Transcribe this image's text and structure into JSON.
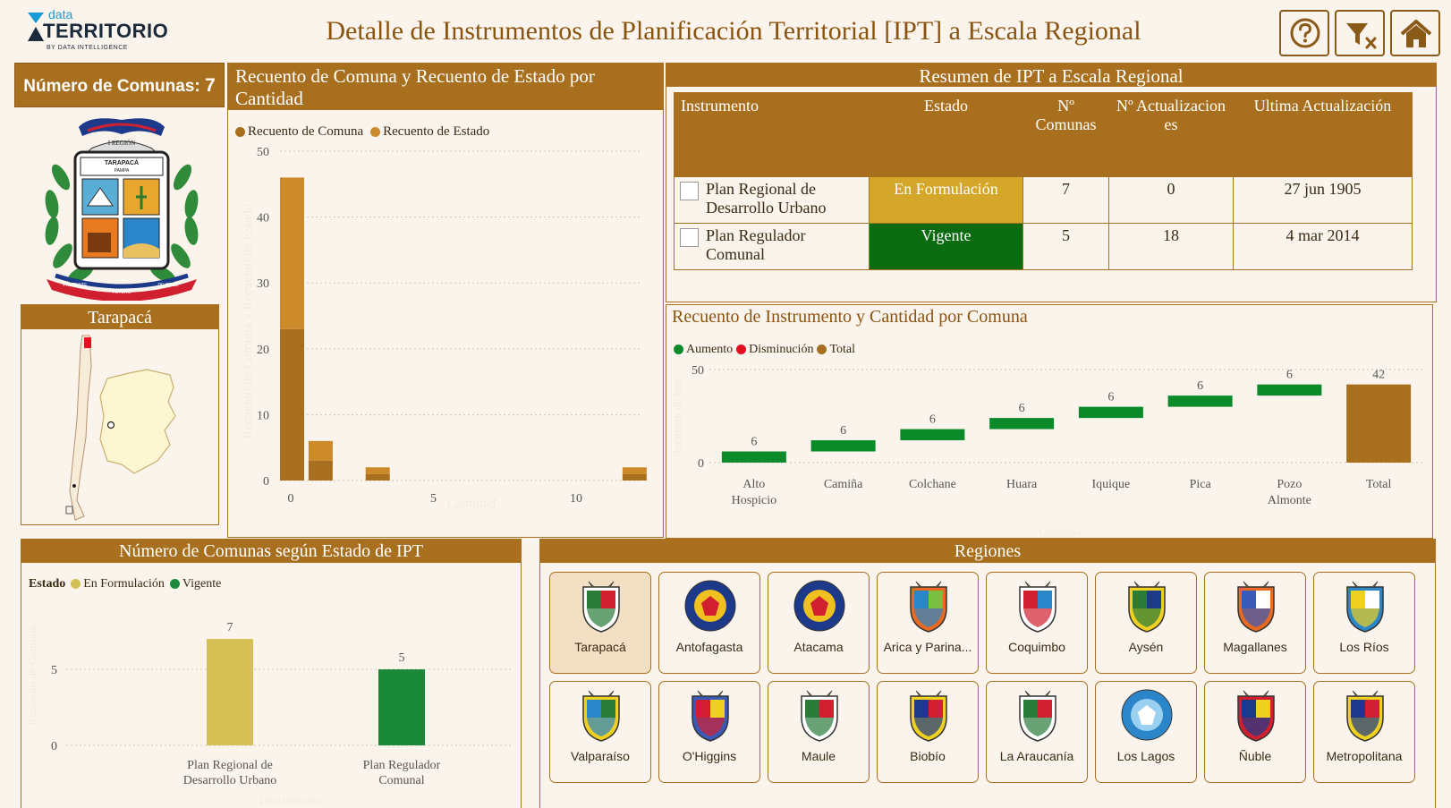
{
  "header": {
    "logo_small": "data",
    "logo_big": "TERRITORIO",
    "logo_sub": "BY DATA INTELLIGENCE",
    "title": "Detalle de Instrumentos de Planificación Territorial [IPT] a Escala Regional",
    "buttons": [
      {
        "name": "help-button",
        "icon": "question-circle-icon"
      },
      {
        "name": "clear-filters-button",
        "icon": "filter-clear-icon"
      },
      {
        "name": "home-button",
        "icon": "home-icon"
      }
    ]
  },
  "comunas_card": {
    "label": "Número de Comunas:",
    "value": "7"
  },
  "emblem": {
    "top_text": "I REGIÓN",
    "name_text": "TARAPACÁ",
    "sub_text": "PAMPA",
    "ribbon": [
      "PRESENTE",
      "FUTURO",
      "DE CHILE"
    ]
  },
  "region_map": {
    "title": "Tarapacá"
  },
  "chart1": {
    "title": "Recuento de Comuna y Recuento de Estado por Cantidad",
    "legend": [
      "Recuento de Comuna",
      "Recuento de Estado"
    ],
    "xlabel": "Cantidad",
    "ylabel": "Recuento de Comuna y Recuento de Estado"
  },
  "summary": {
    "title": "Resumen de IPT a Escala Regional",
    "headers": [
      "Instrumento",
      "Estado",
      "Nº Comunas",
      "Nº Actualizaciones",
      "Ultima Actualización"
    ],
    "rows": [
      {
        "instrumento": "Plan Regional de Desarrollo Urbano",
        "estado": "En Formulación",
        "estado_color": "#d4a72a",
        "comunas": "7",
        "actualizaciones": "0",
        "ultima": "27 jun 1905"
      },
      {
        "instrumento": "Plan Regulador Comunal",
        "estado": "Vigente",
        "estado_color": "#0b6b10",
        "comunas": "5",
        "actualizaciones": "18",
        "ultima": "4 mar 2014"
      }
    ]
  },
  "chart2": {
    "title": "Recuento de Instrumento y Cantidad por Comuna",
    "legend": [
      "Aumento",
      "Disminución",
      "Total"
    ],
    "xlabel": "Comuna",
    "ylabel": "Recuento de Inst"
  },
  "chart3": {
    "title": "Número de Comunas según Estado de IPT",
    "legend_label": "Estado",
    "legend": [
      "En Formulación",
      "Vigente"
    ],
    "xlabel": "Instrumento",
    "ylabel": "Recuento de Comuna"
  },
  "regions": {
    "title": "Regiones",
    "items": [
      {
        "label": "Tarapacá",
        "selected": true,
        "icon": "tarapaca-crest-icon"
      },
      {
        "label": "Antofagasta",
        "selected": false,
        "icon": "antofagasta-crest-icon"
      },
      {
        "label": "Atacama",
        "selected": false,
        "icon": "atacama-crest-icon"
      },
      {
        "label": "Arica y Parina...",
        "selected": false,
        "icon": "arica-crest-icon"
      },
      {
        "label": "Coquimbo",
        "selected": false,
        "icon": "coquimbo-crest-icon"
      },
      {
        "label": "Aysén",
        "selected": false,
        "icon": "aysen-crest-icon"
      },
      {
        "label": "Magallanes",
        "selected": false,
        "icon": "magallanes-crest-icon"
      },
      {
        "label": "Los Ríos",
        "selected": false,
        "icon": "los-rios-crest-icon"
      },
      {
        "label": "Valparaíso",
        "selected": false,
        "icon": "valparaiso-crest-icon"
      },
      {
        "label": "O'Higgins",
        "selected": false,
        "icon": "ohiggins-crest-icon"
      },
      {
        "label": "Maule",
        "selected": false,
        "icon": "maule-crest-icon"
      },
      {
        "label": "Biobío",
        "selected": false,
        "icon": "biobio-crest-icon"
      },
      {
        "label": "La Araucanía",
        "selected": false,
        "icon": "araucania-crest-icon"
      },
      {
        "label": "Los Lagos",
        "selected": false,
        "icon": "los-lagos-crest-icon"
      },
      {
        "label": "Ñuble",
        "selected": false,
        "icon": "nuble-crest-icon"
      },
      {
        "label": "Metropolitana",
        "selected": false,
        "icon": "metropolitana-crest-icon"
      }
    ]
  },
  "chart_data": [
    {
      "type": "bar",
      "title": "Recuento de Comuna y Recuento de Estado por Cantidad",
      "xlabel": "Cantidad",
      "ylabel": "Recuento de Comuna y Recuento de Estado",
      "stacked": true,
      "x": [
        0,
        1,
        3,
        12
      ],
      "x_ticks": [
        0,
        5,
        10
      ],
      "ylim": [
        0,
        50
      ],
      "y_ticks": [
        0,
        10,
        20,
        30,
        40,
        50
      ],
      "series": [
        {
          "name": "Recuento de Comuna",
          "color": "#a8701e",
          "values": [
            23,
            3,
            1,
            1
          ]
        },
        {
          "name": "Recuento de Estado",
          "color": "#cc8a2a",
          "values": [
            23,
            3,
            1,
            1
          ]
        }
      ],
      "grid": true,
      "legend": "top-left"
    },
    {
      "type": "waterfall",
      "title": "Recuento de Instrumento y Cantidad por Comuna",
      "xlabel": "Comuna",
      "ylabel": "Recuento de Inst",
      "categories": [
        "Alto Hospicio",
        "Camiña",
        "Colchane",
        "Huara",
        "Iquique",
        "Pica",
        "Pozo Almonte",
        "Total"
      ],
      "values": [
        6,
        6,
        6,
        6,
        6,
        6,
        6,
        42
      ],
      "series": [
        {
          "name": "Aumento",
          "color": "#0b8a2a"
        },
        {
          "name": "Disminución",
          "color": "#e01020"
        },
        {
          "name": "Total",
          "color": "#a8701e"
        }
      ],
      "ylim": [
        0,
        50
      ],
      "y_ticks": [
        0,
        50
      ],
      "grid": true,
      "legend": "top-left"
    },
    {
      "type": "bar",
      "title": "Número de Comunas según Estado de IPT",
      "xlabel": "Instrumento",
      "ylabel": "Recuento de Comuna",
      "categories": [
        "Plan Regional de Desarrollo Urbano",
        "Plan Regulador Comunal"
      ],
      "values": [
        7,
        5
      ],
      "colors": [
        "#d4c055",
        "#1a8a3a"
      ],
      "series": [
        {
          "name": "En Formulación",
          "color": "#d4c055"
        },
        {
          "name": "Vigente",
          "color": "#1a8a3a"
        }
      ],
      "ylim": [
        0,
        9.3
      ],
      "y_ticks": [
        0,
        5
      ],
      "grid": true,
      "legend": "top-left"
    }
  ]
}
